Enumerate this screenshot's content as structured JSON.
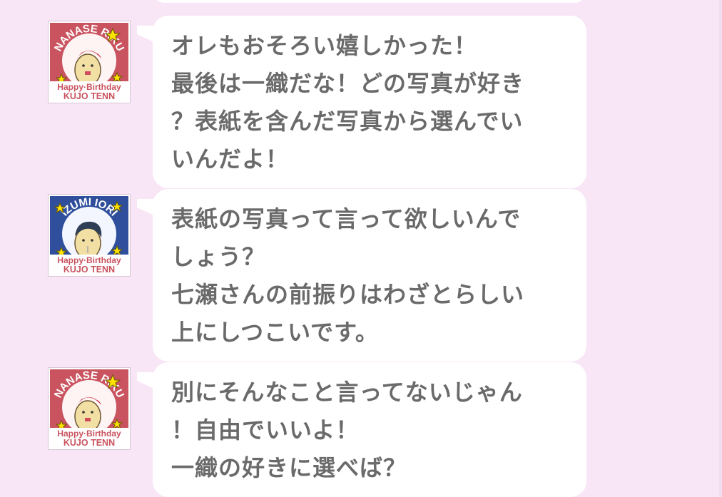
{
  "messages": [
    {
      "avatar": {
        "name": "NANASE RIKU",
        "line1": "Happy·Birthday",
        "line2": "KUJO TENN",
        "frame_color": "#c9535f",
        "name_color": "#ffffff"
      },
      "lines": [
        "オレもおそろい嬉しかった！",
        "最後は一織だな！どの写真が好き",
        "？表紙を含んだ写真から選んでい",
        "いんだよ！"
      ]
    },
    {
      "avatar": {
        "name": "IZUMI IORI",
        "line1": "Happy·Birthday",
        "line2": "KUJO TENN",
        "frame_color": "#2f4f9c",
        "name_color": "#ffffff"
      },
      "lines": [
        "表紙の写真って言って欲しいんで",
        "しょう？",
        "七瀬さんの前振りはわざとらしい",
        "上にしつこいです。"
      ]
    },
    {
      "avatar": {
        "name": "NANASE RIKU",
        "line1": "Happy·Birthday",
        "line2": "KUJO TENN",
        "frame_color": "#c9535f",
        "name_color": "#ffffff"
      },
      "lines": [
        "別にそんなこと言ってないじゃん",
        "！自由でいいよ！",
        "一織の好きに選べば？"
      ]
    }
  ]
}
